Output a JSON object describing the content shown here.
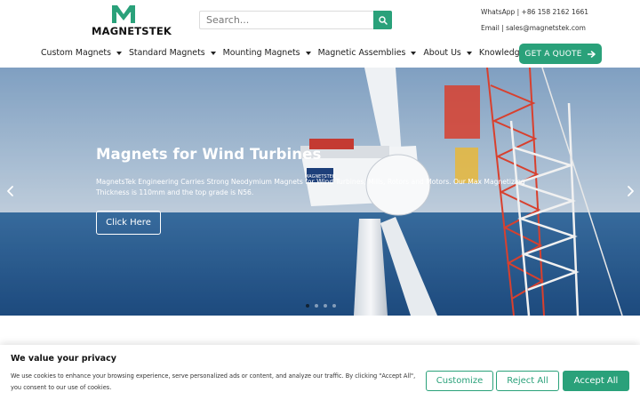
{
  "brand": {
    "name": "MAGNETSTEK",
    "accent_color": "#2aa17a"
  },
  "header": {
    "search": {
      "placeholder": "Search..."
    },
    "whatsapp": "WhatsApp | +86 158 2162 1661",
    "email": "Email | sales@magnetstek.com",
    "quote_label": "GET A QUOTE"
  },
  "nav": {
    "items": [
      {
        "label": "Custom Magnets"
      },
      {
        "label": "Standard Magnets"
      },
      {
        "label": "Mounting Magnets"
      },
      {
        "label": "Magnetic Assemblies"
      },
      {
        "label": "About Us"
      },
      {
        "label": "Knowledge"
      }
    ]
  },
  "hero": {
    "title": "Magnets for Wind Turbines",
    "description": "MagnetsTek Engineering Carries Strong Neodymium Magnets for Wind Turbines, Mills, Rotors and Motors. Our Max Magnetizing Thickness is 110mm and the top grade is N56.",
    "button_label": "Click Here",
    "nacelle_label": "MAGNETSTEK"
  },
  "cookie": {
    "title": "We value your privacy",
    "text": "We use cookies to enhance your browsing experience, serve personalized ads or content, and analyze our traffic. By clicking \"Accept All\", you consent to our use of cookies.",
    "customize_label": "Customize",
    "reject_label": "Reject All",
    "accept_label": "Accept All"
  },
  "icons": {
    "search": "search-icon",
    "arrow_right": "arrow-right-icon",
    "prev": "chevron-left-icon",
    "next": "chevron-right-icon"
  }
}
